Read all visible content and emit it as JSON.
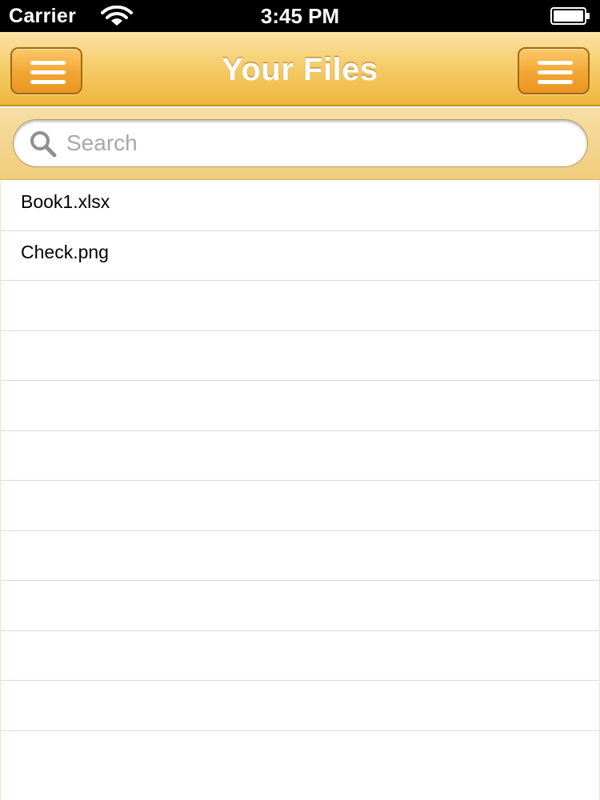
{
  "status_bar": {
    "carrier": "Carrier",
    "time": "3:45 PM",
    "wifi_icon": "wifi-icon",
    "battery_icon": "battery-icon"
  },
  "nav_bar": {
    "title": "Your Files",
    "left_button_icon": "menu-icon",
    "right_button_icon": "menu-icon"
  },
  "search": {
    "placeholder": "Search",
    "value": "",
    "icon": "search-icon"
  },
  "files": [
    {
      "name": "Book1.xlsx"
    },
    {
      "name": "Check.png"
    }
  ],
  "colors": {
    "nav_accent": "#f5cd6c",
    "button_orange": "#f2a633",
    "search_bar_bg": "#f0cc7c"
  }
}
